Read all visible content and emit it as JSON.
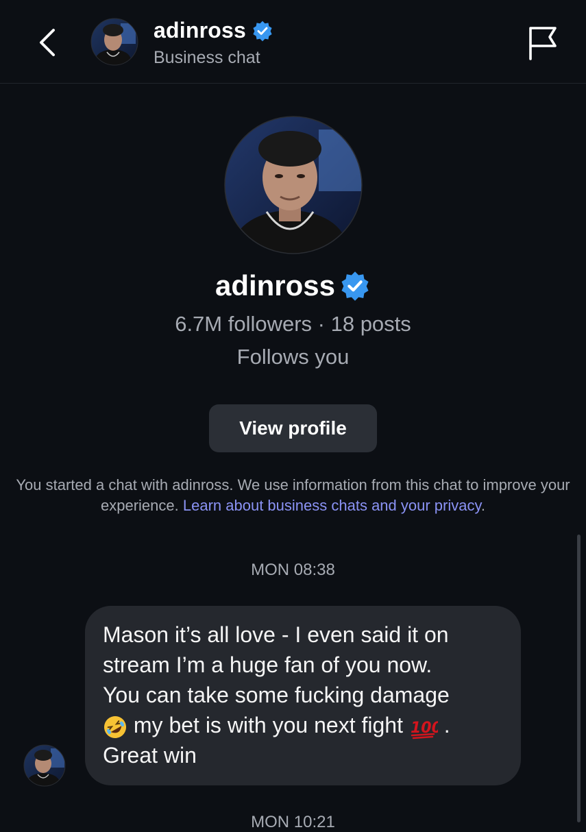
{
  "header": {
    "name": "adinross",
    "subtitle": "Business chat",
    "back_icon": "chevron-left-icon",
    "flag_icon": "flag-icon",
    "verified_icon": "verified-badge-icon"
  },
  "profile": {
    "name": "adinross",
    "stats": "6.7M followers · 18 posts",
    "follows_you": "Follows you",
    "view_profile_label": "View profile"
  },
  "notice": {
    "text": "You started a chat with adinross. We use information from this chat to improve your experience.",
    "link": "Learn about business chats and your privacy",
    "period": "."
  },
  "chat": {
    "timestamp": "MON 08:38",
    "next_timestamp": "MON 10:21",
    "message": {
      "line1": "Mason it’s all love - I even said it on",
      "line2": "stream I’m a huge fan of you now.",
      "line3": "You can take some fucking damage",
      "line4_a": "my bet is with you next fight",
      "line4_b": ".",
      "line5": "Great win",
      "emoji_1": "rolling-on-floor-laughing-emoji",
      "emoji_2": "hundred-points-emoji"
    }
  },
  "colors": {
    "background": "#0c0f14",
    "bubble": "#25282e",
    "button": "#2b2f36",
    "link": "#8b93f5",
    "verified": "#3897f0",
    "muted_text": "#a7abb3"
  }
}
